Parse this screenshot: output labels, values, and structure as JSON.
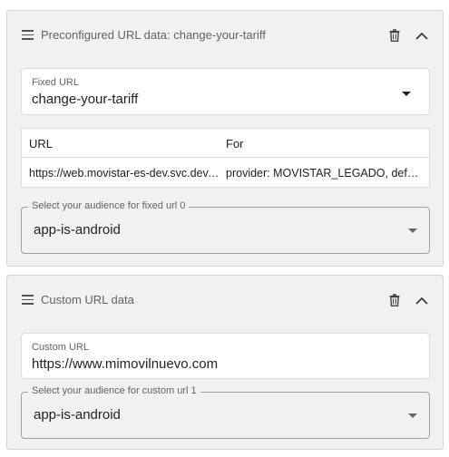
{
  "panels": [
    {
      "title": "Preconfigured URL data: change-your-tariff",
      "fixed_url": {
        "label": "Fixed URL",
        "value": "change-your-tariff"
      },
      "table": {
        "columns": [
          "URL",
          "For"
        ],
        "rows": [
          {
            "url": "https://web.movistar-es-dev.svc.dev.…",
            "for": "provider: MOVISTAR_LEGADO, def…"
          }
        ]
      },
      "audience": {
        "label": "Select your audience for fixed url 0",
        "value": "app-is-android"
      }
    },
    {
      "title": "Custom URL data",
      "custom_url": {
        "label": "Custom URL",
        "value": "https://www.mimovilnuevo.com"
      },
      "audience": {
        "label": "Select your audience for custom url 1",
        "value": "app-is-android"
      }
    }
  ],
  "icons": {
    "drag": "drag-handle-icon",
    "delete": "trash-icon",
    "collapse": "chevron-up-icon",
    "dropdown": "caret-down-icon"
  }
}
